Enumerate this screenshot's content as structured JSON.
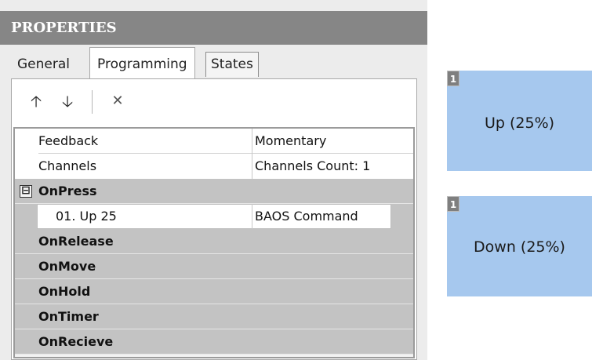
{
  "top_marks": "' ' ,",
  "panel": {
    "title": "PROPERTIES"
  },
  "tabs": [
    {
      "label": "General"
    },
    {
      "label": "Programming"
    },
    {
      "label": "States"
    }
  ],
  "toolbar": {
    "up_icon": "arrow-up-icon",
    "up_glyph": "🡡",
    "down_icon": "arrow-down-icon",
    "down_glyph": "🡣",
    "delete_icon": "close-icon",
    "delete_glyph": "✕"
  },
  "grid": {
    "properties": [
      {
        "name": "Feedback",
        "value": "Momentary"
      },
      {
        "name": "Channels",
        "value": "Channels Count: 1"
      }
    ],
    "events": [
      {
        "name": "OnPress",
        "expanded": true,
        "expander": "⊟",
        "children": [
          {
            "name": "01. Up 25",
            "value": "BAOS Command"
          }
        ]
      },
      {
        "name": "OnRelease"
      },
      {
        "name": "OnMove"
      },
      {
        "name": "OnHold"
      },
      {
        "name": "OnTimer"
      },
      {
        "name": "OnRecieve"
      }
    ]
  },
  "tiles": [
    {
      "badge": "1",
      "label": "Up (25%)"
    },
    {
      "badge": "1",
      "label": "Down (25%)"
    }
  ],
  "colors": {
    "header_bg": "#868686",
    "event_row_bg": "#c3c3c3",
    "tile_bg": "#a6c8ee",
    "badge_bg": "#7f7f7f"
  }
}
